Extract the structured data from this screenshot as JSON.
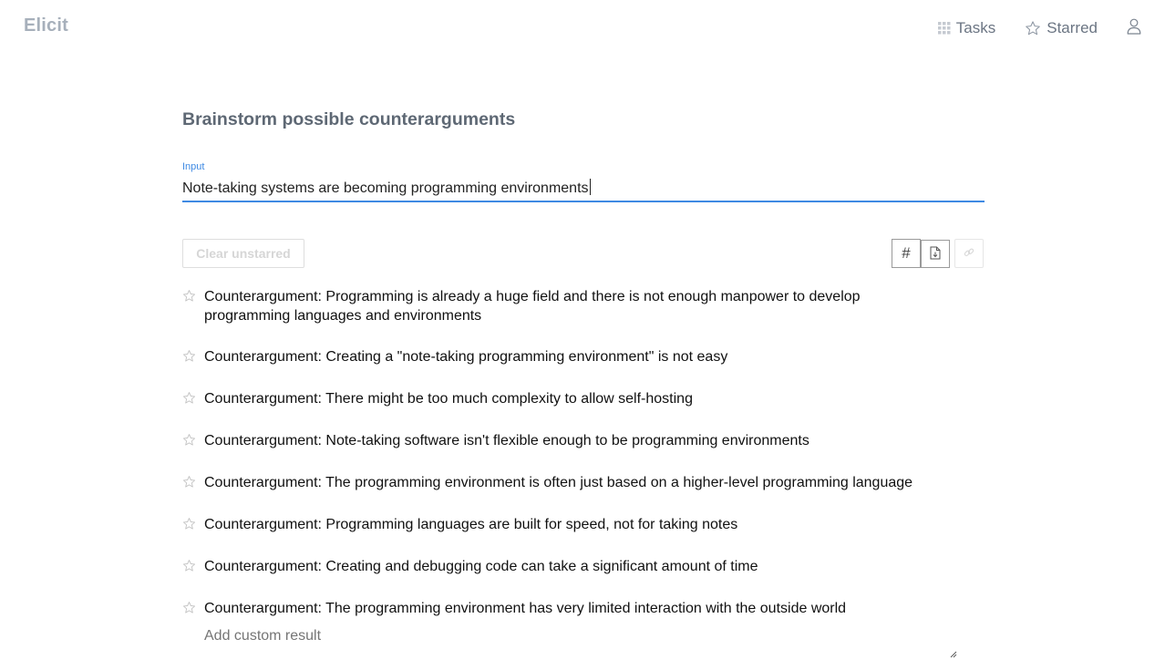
{
  "app": {
    "logo": "Elicit"
  },
  "nav": {
    "items": [
      {
        "label": "Tasks",
        "icon": "grid-icon"
      },
      {
        "label": "Starred",
        "icon": "star-outline-icon"
      }
    ],
    "user_icon": "user-icon"
  },
  "page": {
    "title": "Brainstorm possible counterarguments"
  },
  "input": {
    "label": "Input",
    "value": "Note-taking systems are becoming programming environments"
  },
  "toolbar": {
    "clear_label": "Clear unstarred",
    "hash_label": "#",
    "export_icon": "file-download-icon",
    "link_icon": "link-icon"
  },
  "results": [
    {
      "text": "Counterargument: Programming is already a huge field and there is not enough manpower to develop programming languages and environments",
      "starred": false
    },
    {
      "text": "Counterargument: Creating a \"note-taking programming environment\" is not easy",
      "starred": false
    },
    {
      "text": "Counterargument: There might be too much complexity to allow self-hosting",
      "starred": false
    },
    {
      "text": "Counterargument: Note-taking software isn't flexible enough to be programming environments",
      "starred": false
    },
    {
      "text": "Counterargument: The programming environment is often just based on a higher-level programming language",
      "starred": false
    },
    {
      "text": "Counterargument: Programming languages are built for speed, not for taking notes",
      "starred": false
    },
    {
      "text": "Counterargument: Creating and debugging code can take a significant amount of time",
      "starred": false
    },
    {
      "text": "Counterargument: The programming environment has very limited interaction with the outside world",
      "starred": false
    }
  ],
  "custom": {
    "placeholder": "Add custom result"
  },
  "colors": {
    "accent": "#3f8ae3",
    "logo": "#a7b0bb",
    "nav_text": "#6b7583",
    "title": "#5e6874"
  }
}
